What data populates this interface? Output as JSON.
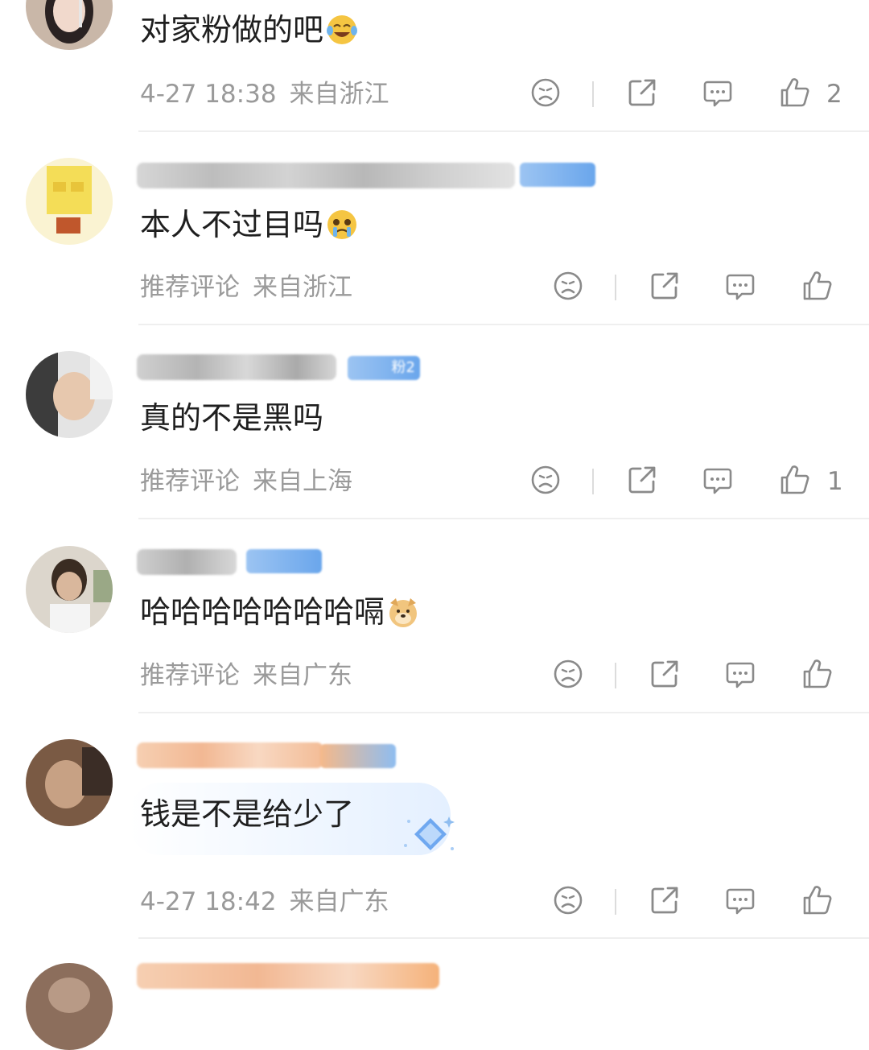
{
  "comments": [
    {
      "text": "对家粉做的吧",
      "emoji": "laughing-crying-emoji",
      "time": "4-27 18:38",
      "location": "来自浙江",
      "likes": "2"
    },
    {
      "text": "本人不过目吗",
      "emoji": "pleading-crying-emoji",
      "time": "推荐评论",
      "location": "来自浙江",
      "likes": ""
    },
    {
      "text": "真的不是黑吗",
      "emoji": "",
      "time": "推荐评论",
      "location": "来自上海",
      "likes": "1",
      "badge": "粉2"
    },
    {
      "text": "哈哈哈哈哈哈哈嗝",
      "emoji": "doge-emoji",
      "time": "推荐评论",
      "location": "来自广东",
      "likes": ""
    },
    {
      "text": "钱是不是给少了",
      "emoji": "",
      "time": "4-27 18:42",
      "location": "来自广东",
      "likes": ""
    }
  ],
  "icons": {
    "dislike": "sad-face-icon",
    "share": "share-icon",
    "reply": "comment-bubble-icon",
    "like": "thumbs-up-icon"
  },
  "colors": {
    "meta_text": "#9a9a9a",
    "icon_stroke": "#8a8a8a",
    "badge_blue": "#6aa6ec"
  }
}
